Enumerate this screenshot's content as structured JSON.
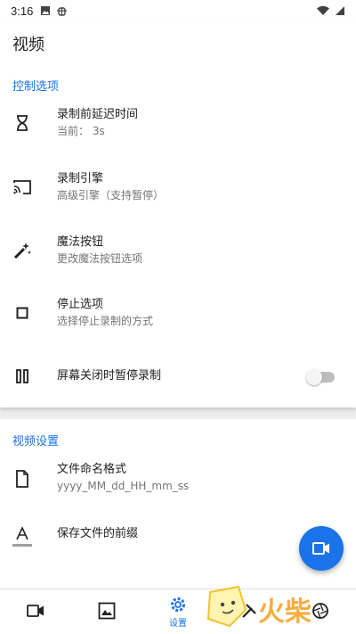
{
  "status_bar": {
    "time": "3:16",
    "icons": [
      "image-icon",
      "bug-icon",
      "wifi-icon",
      "signal-icon"
    ]
  },
  "page": {
    "title": "视频"
  },
  "sections": {
    "control": {
      "header": "控制选项",
      "items": [
        {
          "icon": "hourglass-icon",
          "title": "录制前延迟时间",
          "summary": "当前：  3s"
        },
        {
          "icon": "cast-icon",
          "title": "录制引擎",
          "summary": "高级引擎（支持暂停）"
        },
        {
          "icon": "magic-wand-icon",
          "title": "魔法按钮",
          "summary": "更改魔法按钮选项"
        },
        {
          "icon": "stop-icon",
          "title": "停止选项",
          "summary": "选择停止录制的方式"
        },
        {
          "icon": "pause-icon",
          "title": "屏幕关闭时暂停录制",
          "toggle_on": false
        }
      ]
    },
    "video": {
      "header": "视频设置",
      "items": [
        {
          "icon": "file-icon",
          "title": "文件命名格式",
          "summary": "yyyy_MM_dd_HH_mm_ss"
        },
        {
          "icon": "text-format-icon",
          "title": "保存文件的前缀"
        }
      ]
    }
  },
  "fab": {
    "icon": "videocam-icon"
  },
  "bottom_nav": {
    "items": [
      {
        "icon": "videocam-icon",
        "label": ""
      },
      {
        "icon": "photo-icon",
        "label": ""
      },
      {
        "icon": "settings-icon",
        "label": "设置",
        "selected": true
      },
      {
        "icon": "tools-icon",
        "label": ""
      },
      {
        "icon": "aperture-icon",
        "label": ""
      }
    ]
  },
  "watermark": {
    "text": "火柴"
  },
  "colors": {
    "accent": "#1a73e8",
    "background": "#ececec",
    "surface": "#ffffff"
  }
}
